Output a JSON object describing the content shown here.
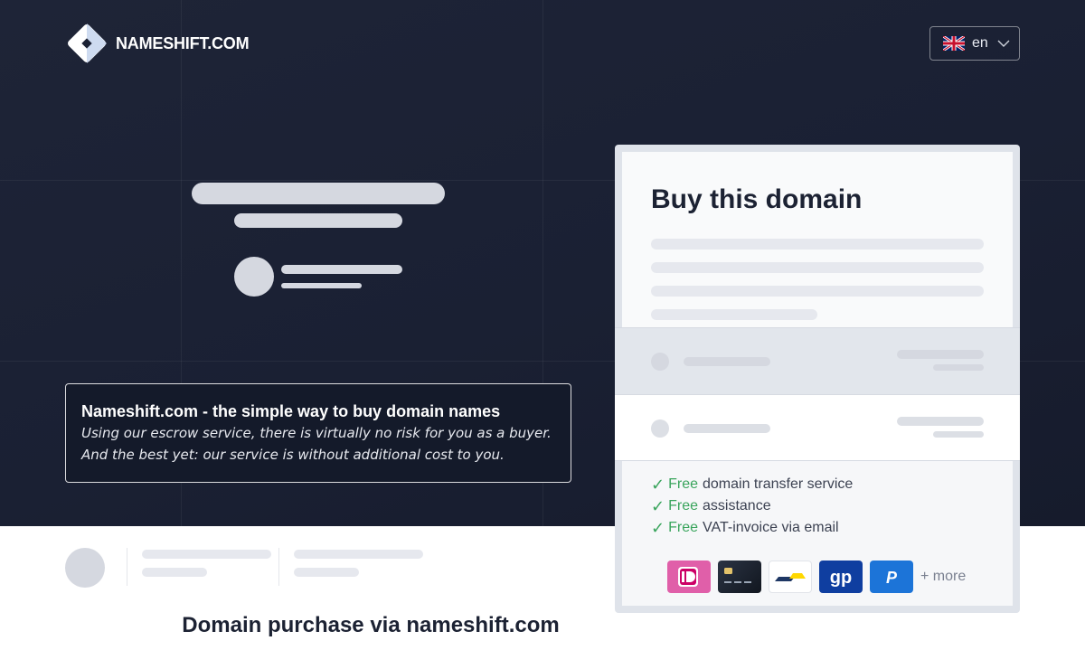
{
  "header": {
    "brand": "NAMESHIFT.COM",
    "language": "en"
  },
  "info": {
    "title": "Nameshift.com - the simple way to buy domain names",
    "text": "Using our escrow service, there is virtually no risk for you as a buyer. And the best yet: our service is without additional cost to you."
  },
  "card": {
    "title": "Buy this domain",
    "features": [
      {
        "free": "Free",
        "text": "domain transfer service"
      },
      {
        "free": "Free",
        "text": "assistance"
      },
      {
        "free": "Free",
        "text": "VAT-invoice via email"
      }
    ],
    "payment_methods": [
      "ideal-icon",
      "credit-card-icon",
      "bancontact-icon",
      "giropay-icon",
      "paypal-icon"
    ],
    "more_label": "+ more"
  },
  "footer": {
    "title": "Domain purchase via nameshift.com"
  },
  "colors": {
    "hero_bg": "#1a2033",
    "accent_green": "#3aa55d",
    "card_border": "#dfe3ea"
  }
}
